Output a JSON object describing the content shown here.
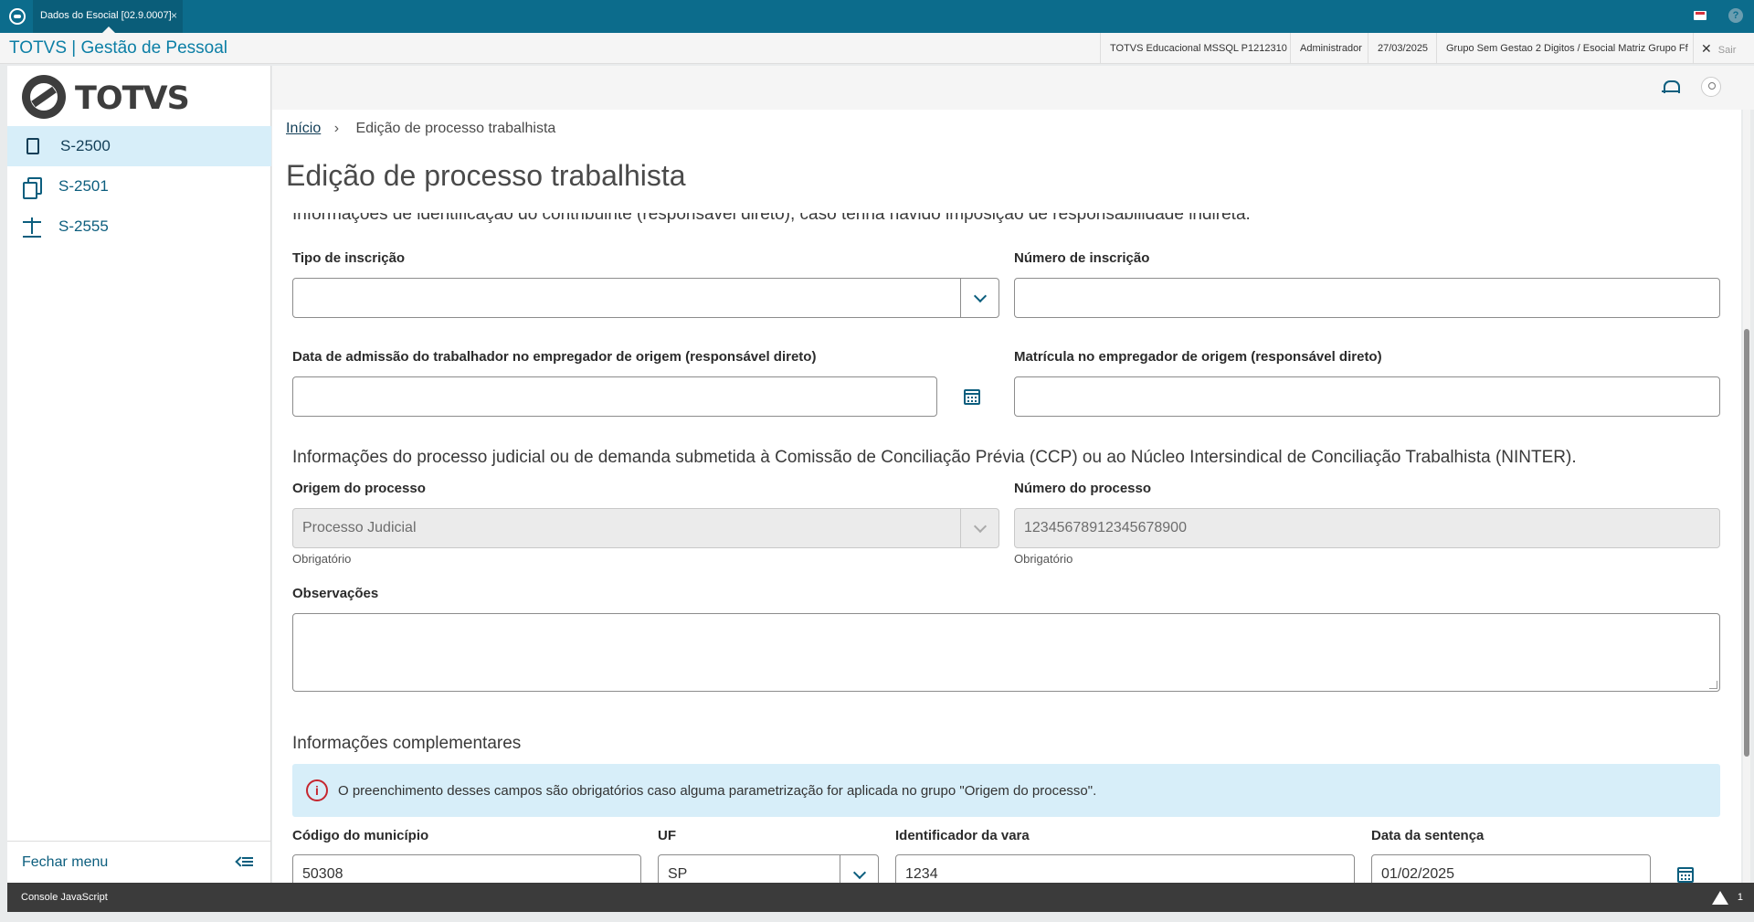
{
  "window": {
    "tab_title": "Dados do Esocial [02.9.0007]",
    "tab_close": "×",
    "help_glyph": "?"
  },
  "header": {
    "app_title": "TOTVS | Gestão de Pessoal",
    "environment": "TOTVS Educacional MSSQL P1212310",
    "user": "Administrador",
    "date": "27/03/2025",
    "company": "Grupo Sem Gestao 2 Digitos / Esocial Matriz Grupo Ff",
    "exit_label": "Sair",
    "exit_glyph": "✕"
  },
  "sidebar": {
    "logo_text": "TOTVS",
    "items": [
      {
        "label": "S-2500",
        "icon": "file-icon",
        "active": true
      },
      {
        "label": "S-2501",
        "icon": "copy-icon",
        "active": false
      },
      {
        "label": "S-2555",
        "icon": "scale-icon",
        "active": false
      }
    ],
    "close_menu_label": "Fechar menu"
  },
  "breadcrumb": {
    "home": "Início",
    "separator": "›",
    "current": "Edição de processo trabalhista"
  },
  "page_title": "Edição de processo trabalhista",
  "form": {
    "cut_off_text": "Informações de identificação do contribuinte (responsável direto), caso tenha havido imposição de responsabilidade indireta.",
    "tipo_inscricao": {
      "label": "Tipo de inscrição",
      "value": ""
    },
    "numero_inscricao": {
      "label": "Número de inscrição",
      "value": ""
    },
    "data_admissao": {
      "label": "Data de admissão do trabalhador no empregador de origem (responsável direto)",
      "value": ""
    },
    "matricula": {
      "label": "Matrícula no empregador de origem (responsável direto)",
      "value": ""
    },
    "processo_section": "Informações do processo judicial ou de demanda submetida à Comissão de Conciliação Prévia (CCP) ou ao Núcleo Intersindical de Conciliação Trabalhista (NINTER).",
    "origem_processo": {
      "label": "Origem do processo",
      "value": "Processo Judicial",
      "helper": "Obrigatório"
    },
    "numero_processo": {
      "label": "Número do processo",
      "value": "12345678912345678900",
      "helper": "Obrigatório"
    },
    "observacoes": {
      "label": "Observações",
      "value": ""
    },
    "complementares_section": "Informações complementares",
    "alert_text": "O preenchimento desses campos são obrigatórios caso alguma parametrização for aplicada no grupo \"Origem do processo\".",
    "alert_glyph": "i",
    "codigo_municipio": {
      "label": "Código do município",
      "value": "50308"
    },
    "uf": {
      "label": "UF",
      "value": "SP"
    },
    "identificador_vara": {
      "label": "Identificador da vara",
      "value": "1234"
    },
    "data_sentenca": {
      "label": "Data da sentença",
      "value": "01/02/2025"
    }
  },
  "console": {
    "label": "Console JavaScript",
    "warning_count": "1"
  },
  "colors": {
    "brand_teal": "#0c6c8c",
    "nav_active_bg": "#d7eef9",
    "alert_red": "#c5262f"
  }
}
